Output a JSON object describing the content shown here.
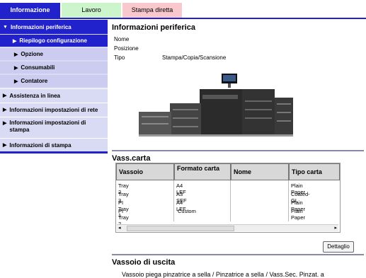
{
  "tabs": {
    "info": "Informazione",
    "work": "Lavoro",
    "direct_print": "Stampa diretta"
  },
  "sidebar": {
    "items": [
      {
        "label": "Informazioni periferica"
      },
      {
        "label": "Riepilogo configurazione"
      },
      {
        "label": "Opzione"
      },
      {
        "label": "Consumabili"
      },
      {
        "label": "Contatore"
      },
      {
        "label": "Assistenza in linea"
      },
      {
        "label": "Informazioni impostazioni di rete"
      },
      {
        "label": "Informazioni impostazioni di stampa"
      },
      {
        "label": "Informazioni di stampa"
      }
    ]
  },
  "main": {
    "title": "Informazioni periferica",
    "fields": [
      {
        "key": "Nome",
        "value": ""
      },
      {
        "key": "Posizione",
        "value": ""
      },
      {
        "key": "Tipo",
        "value": "Stampa/Copia/Scansione"
      }
    ],
    "paper_section_title": "Vass.carta",
    "table": {
      "headers": [
        "Vassoio",
        "Formato carta",
        "Nome",
        "Tipo carta"
      ],
      "rows": [
        [
          "Tray 2",
          "A4 LEF",
          "",
          "Plain Paper"
        ],
        [
          "Tray 3",
          "A3 SEF",
          "",
          "Coated-GL"
        ],
        [
          "PI Tray 1",
          "A4 LEF",
          "",
          "Plain Paper"
        ],
        [
          "PI Tray 2",
          "Custom",
          "",
          "Plain Paper"
        ]
      ]
    },
    "detail_button": "Dettaglio",
    "output_section_title": "Vassoio di uscita",
    "output_text": "Vassoio piega pinzatrice a sella / Pinzatrice a sella / Vass.Sec. Pinzat. a"
  },
  "colors": {
    "accent": "#2222cc",
    "sidebar_bg": "#d9daf3",
    "tab_work": "#ccf5cc",
    "tab_print": "#f8c8cc"
  }
}
